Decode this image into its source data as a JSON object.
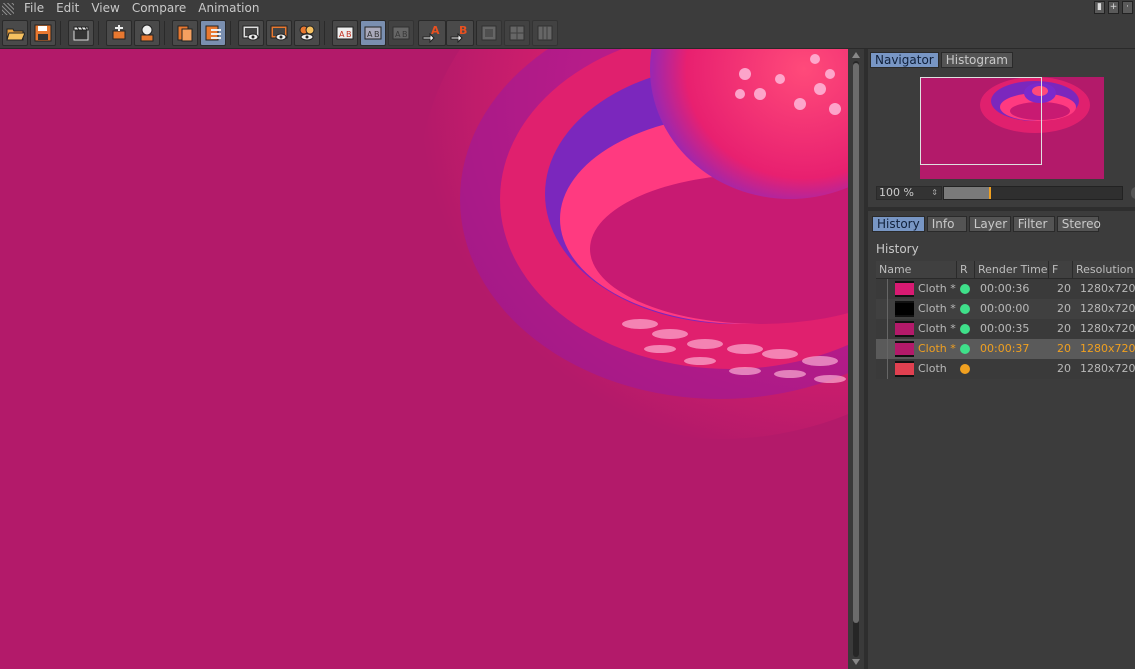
{
  "menu": [
    "File",
    "Edit",
    "View",
    "Compare",
    "Animation"
  ],
  "window_controls": [
    "▮",
    "+",
    "·"
  ],
  "colors": {
    "render_bg": "#b31a6a",
    "accent_tab": "#7896c4",
    "selected_text": "#f0a020",
    "status_done": "#3fe08a",
    "status_pending": "#f0a020"
  },
  "toolbar": {
    "icons": [
      "open-icon",
      "save-icon",
      "clapper-icon",
      "cleanup-icon",
      "render-icon",
      "copy-icon",
      "list-icon",
      "region-icon",
      "region-eye-icon",
      "cut-eye-icon",
      "ab-compare-icon",
      "ab-overlay-icon",
      "ab-swap-icon",
      "set-a-icon",
      "set-b-icon",
      "split-1-icon",
      "split-2-icon",
      "split-3-icon"
    ],
    "ab_labels": [
      "A",
      "B"
    ]
  },
  "navigator": {
    "tabs": [
      "Navigator",
      "Histogram"
    ],
    "zoom_value": "100 %",
    "zoom_fraction": 0.25
  },
  "history": {
    "tabs": [
      "History",
      "Info",
      "Layer",
      "Filter",
      "Stereo"
    ],
    "title": "History",
    "columns": [
      "Name",
      "R",
      "Render Time",
      "F",
      "Resolution"
    ],
    "rows": [
      {
        "name": "Cloth *",
        "time": "00:00:36",
        "frames": "20",
        "res": "1280x720",
        "status": "done",
        "thumb": "#d81a72"
      },
      {
        "name": "Cloth *",
        "time": "00:00:00",
        "frames": "20",
        "res": "1280x720",
        "status": "done",
        "thumb": "#000000"
      },
      {
        "name": "Cloth *",
        "time": "00:00:35",
        "frames": "20",
        "res": "1280x720",
        "status": "done",
        "thumb": "#b31a6a"
      },
      {
        "name": "Cloth *",
        "time": "00:00:37",
        "frames": "20",
        "res": "1280x720",
        "status": "done",
        "thumb": "#b31a6a",
        "selected": true
      },
      {
        "name": "Cloth",
        "time": "",
        "frames": "20",
        "res": "1280x720",
        "status": "pending",
        "thumb": "#e04050"
      }
    ]
  }
}
